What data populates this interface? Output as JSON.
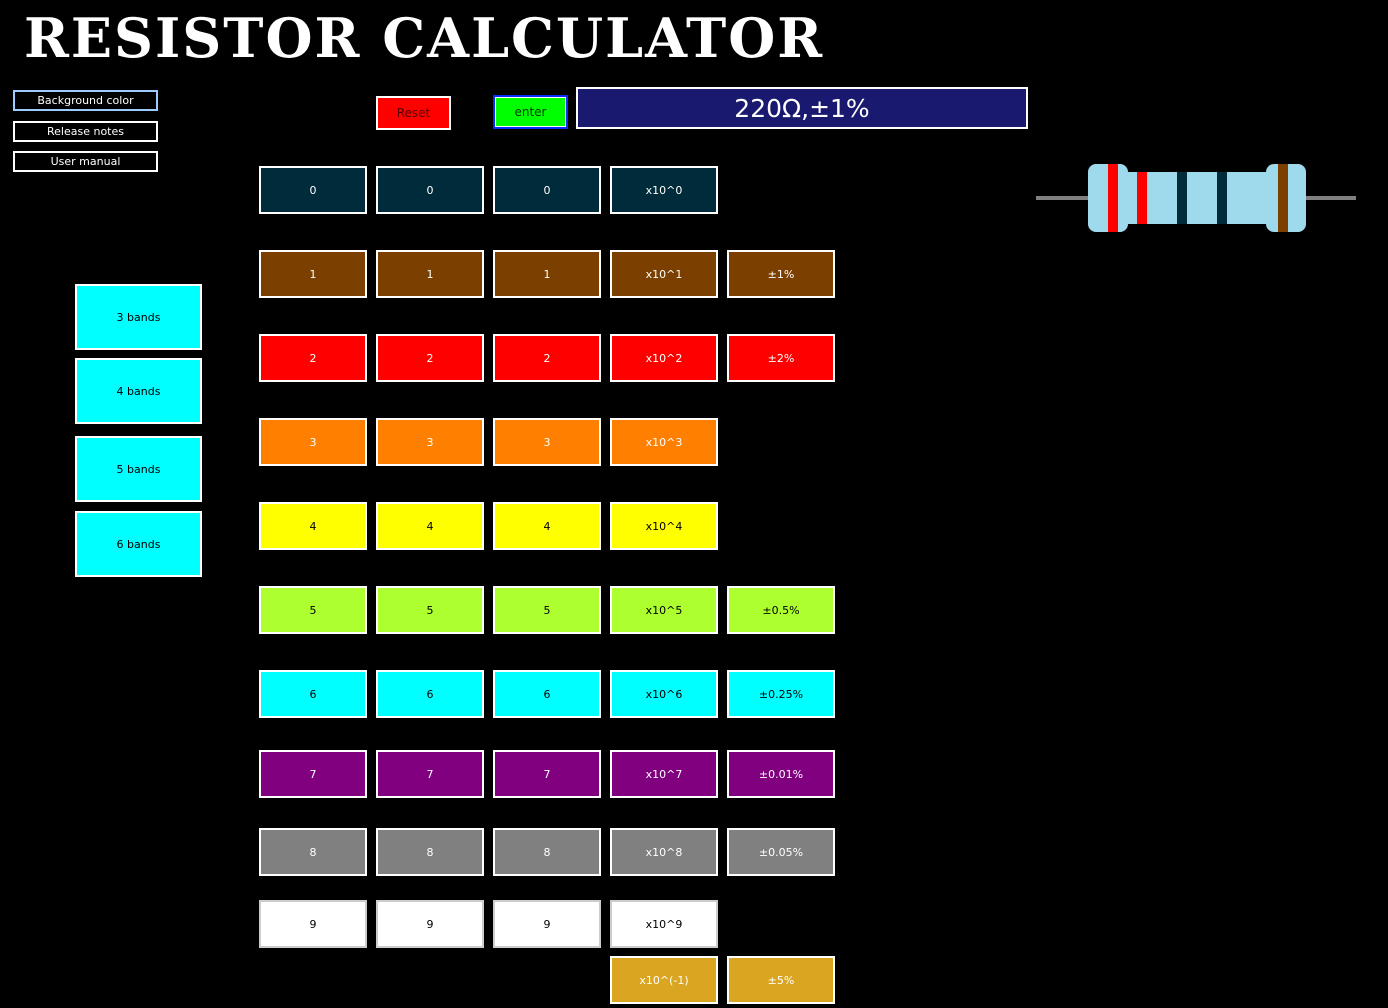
{
  "title": "RESISTOR CALCULATOR",
  "side_menu": [
    {
      "label": "Background color"
    },
    {
      "label": "Release notes"
    },
    {
      "label": "User manual"
    }
  ],
  "band_buttons": [
    {
      "label": "3 bands"
    },
    {
      "label": "4 bands"
    },
    {
      "label": "5 bands"
    },
    {
      "label": "6 bands"
    }
  ],
  "controls": {
    "reset_label": "Reset",
    "enter_label": "enter",
    "result": "220Ω,±1%"
  },
  "color_rows": [
    {
      "color": "black",
      "bg": "#002b3a",
      "fg": "#ffffff",
      "digits": [
        "0",
        "0",
        "0"
      ],
      "multiplier": "x10^0",
      "tolerance": null
    },
    {
      "color": "brown",
      "bg": "#7b3f00",
      "fg": "#ffffff",
      "digits": [
        "1",
        "1",
        "1"
      ],
      "multiplier": "x10^1",
      "tolerance": "±1%"
    },
    {
      "color": "red",
      "bg": "#ff0000",
      "fg": "#ffffff",
      "digits": [
        "2",
        "2",
        "2"
      ],
      "multiplier": "x10^2",
      "tolerance": "±2%"
    },
    {
      "color": "orange",
      "bg": "#ff8000",
      "fg": "#ffffff",
      "digits": [
        "3",
        "3",
        "3"
      ],
      "multiplier": "x10^3",
      "tolerance": null
    },
    {
      "color": "yellow",
      "bg": "#ffff00",
      "fg": "#000000",
      "digits": [
        "4",
        "4",
        "4"
      ],
      "multiplier": "x10^4",
      "tolerance": null
    },
    {
      "color": "green",
      "bg": "#adff2f",
      "fg": "#000000",
      "digits": [
        "5",
        "5",
        "5"
      ],
      "multiplier": "x10^5",
      "tolerance": "±0.5%"
    },
    {
      "color": "blue",
      "bg": "#00ffff",
      "fg": "#000000",
      "digits": [
        "6",
        "6",
        "6"
      ],
      "multiplier": "x10^6",
      "tolerance": "±0.25%"
    },
    {
      "color": "violet",
      "bg": "#800080",
      "fg": "#ffffff",
      "digits": [
        "7",
        "7",
        "7"
      ],
      "multiplier": "x10^7",
      "tolerance": "±0.01%"
    },
    {
      "color": "gray",
      "bg": "#808080",
      "fg": "#ffffff",
      "digits": [
        "8",
        "8",
        "8"
      ],
      "multiplier": "x10^8",
      "tolerance": "±0.05%"
    },
    {
      "color": "white",
      "bg": "#ffffff",
      "fg": "#000000",
      "digits": [
        "9",
        "9",
        "9"
      ],
      "multiplier": "x10^9",
      "tolerance": null
    },
    {
      "color": "gold",
      "bg": "#daa520",
      "fg": "#ffffff",
      "digits": [
        null,
        null,
        null
      ],
      "multiplier": "x10^(-1)",
      "tolerance": "±5%"
    }
  ],
  "resistor_preview": {
    "body_color": "#9fd9ec",
    "lead_color": "#808080",
    "bands": [
      "#ff0000",
      "#ff0000",
      "#002b3a",
      "#002b3a",
      "#7b3f00"
    ]
  }
}
